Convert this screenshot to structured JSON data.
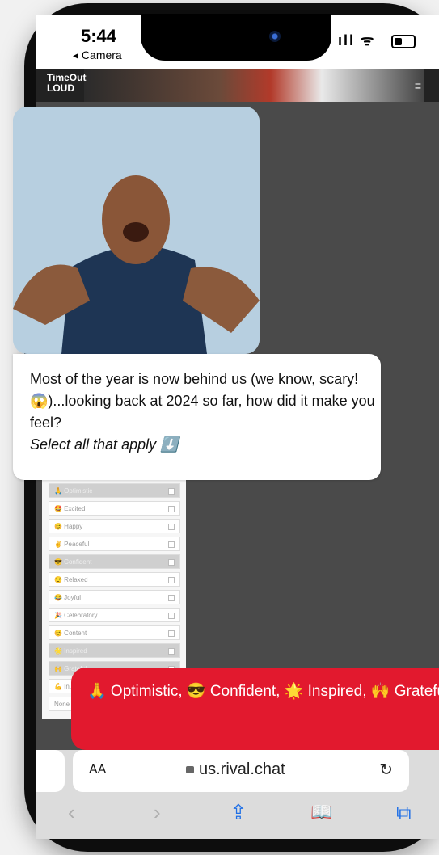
{
  "status": {
    "time": "5:44",
    "back_label": "◂ Camera",
    "signal": "ıll ᯤ"
  },
  "site": {
    "logo_line1": "TimeOut",
    "logo_line2": "LOUD",
    "menu_glyph": "≡"
  },
  "message": {
    "text_main": "Most of the year is now behind us (we know, scary!😱)...looking back at 2024 so far, how did it make you feel?",
    "text_instruction": "Select all that apply ⬇️"
  },
  "options": [
    {
      "label": "🙏 Optimistic",
      "selected": true
    },
    {
      "label": "🤩 Excited",
      "selected": false
    },
    {
      "label": "😊 Happy",
      "selected": false
    },
    {
      "label": "✌️ Peaceful",
      "selected": false
    },
    {
      "label": "😎 Confident",
      "selected": true
    },
    {
      "label": "😌 Relaxed",
      "selected": false
    },
    {
      "label": "😂 Joyful",
      "selected": false
    },
    {
      "label": "🎉 Celebratory",
      "selected": false
    },
    {
      "label": "😊 Content",
      "selected": false
    },
    {
      "label": "🌟 Inspired",
      "selected": true
    },
    {
      "label": "🙌 Grateful",
      "selected": true
    },
    {
      "label": "💪 In...",
      "selected": false
    },
    {
      "label": "None",
      "selected": false
    }
  ],
  "reply": {
    "text": "🙏 Optimistic, 😎 Confident, 🌟 Inspired, 🙌 Grateful"
  },
  "browser": {
    "aa_label": "AA",
    "url": "us.rival.chat",
    "reload_glyph": "↻",
    "back_glyph": "‹",
    "forward_glyph": "›",
    "share_glyph": "⇪",
    "bookmarks_glyph": "📖",
    "tabs_glyph": "⧉"
  }
}
